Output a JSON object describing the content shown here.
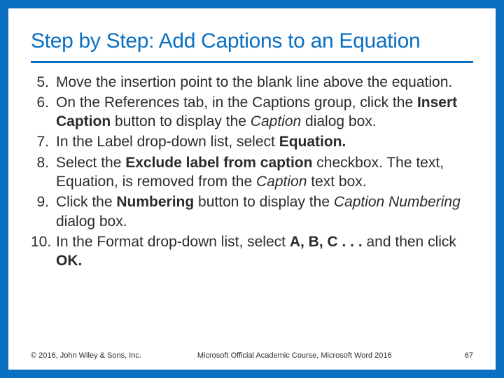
{
  "title": "Step by Step: Add Captions to an Equation",
  "items": [
    {
      "num": "5.",
      "html": "Move the insertion point to the blank line above the equation."
    },
    {
      "num": "6.",
      "html": "On the References tab, in the Captions group, click the <b>Insert Caption</b> button to display the <i>Caption</i> dialog box."
    },
    {
      "num": "7.",
      "html": "In the Label drop-down list, select <b>Equation.</b>"
    },
    {
      "num": "8.",
      "html": "Select the <b>Exclude label from caption</b> checkbox. The text, Equation, is removed from the <i>Caption</i> text box."
    },
    {
      "num": "9.",
      "html": "Click the <b>Numbering</b> button to display the <i>Caption Numbering</i> dialog box."
    },
    {
      "num": "10.",
      "html": "In the Format drop-down list, select <b>A, B, C . . .</b> and then click <b>OK.</b>"
    }
  ],
  "footer": {
    "copyright": "© 2016, John Wiley & Sons, Inc.",
    "course": "Microsoft Official Academic Course, Microsoft Word 2016",
    "page": "67"
  }
}
